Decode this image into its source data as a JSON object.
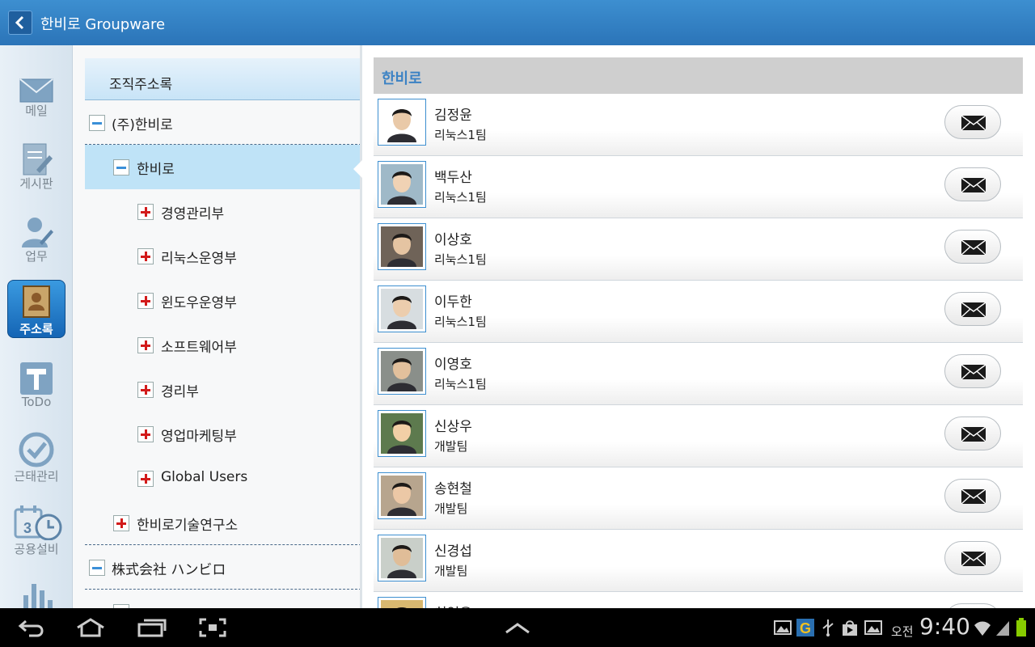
{
  "header": {
    "title": "한비로 Groupware"
  },
  "rail": {
    "items": [
      {
        "label": "메일"
      },
      {
        "label": "게시판"
      },
      {
        "label": "업무"
      },
      {
        "label": "주소록"
      },
      {
        "label": "ToDo"
      },
      {
        "label": "근태관리"
      },
      {
        "label": "공용설비"
      }
    ],
    "calendar_day": "3"
  },
  "tree": {
    "title": "조직주소록",
    "nodes": [
      {
        "label": "(주)한비로"
      },
      {
        "label": "한비로"
      },
      {
        "label": "경영관리부"
      },
      {
        "label": "리눅스운영부"
      },
      {
        "label": "윈도우운영부"
      },
      {
        "label": "소프트웨어부"
      },
      {
        "label": "경리부"
      },
      {
        "label": "영업마케팅부"
      },
      {
        "label": "Global Users"
      },
      {
        "label": "한비로기술연구소"
      },
      {
        "label": "株式会社 ハンビロ"
      }
    ]
  },
  "contacts": {
    "group": "한비로",
    "people": [
      {
        "name": "김정윤",
        "dept": "리눅스1팀"
      },
      {
        "name": "백두산",
        "dept": "리눅스1팀"
      },
      {
        "name": "이상호",
        "dept": "리눅스1팀"
      },
      {
        "name": "이두한",
        "dept": "리눅스1팀"
      },
      {
        "name": "이영호",
        "dept": "리눅스1팀"
      },
      {
        "name": "신상우",
        "dept": "개발팀"
      },
      {
        "name": "송현철",
        "dept": "개발팀"
      },
      {
        "name": "신경섭",
        "dept": "개발팀"
      },
      {
        "name": "최영은",
        "dept": ""
      }
    ]
  },
  "statusbar": {
    "ampm": "오전",
    "time": "9:40"
  },
  "colors": {
    "header": "#2b74b8",
    "accent": "#3d8fd0",
    "selected": "#bfe3f7",
    "plus": "#d21b1b"
  }
}
